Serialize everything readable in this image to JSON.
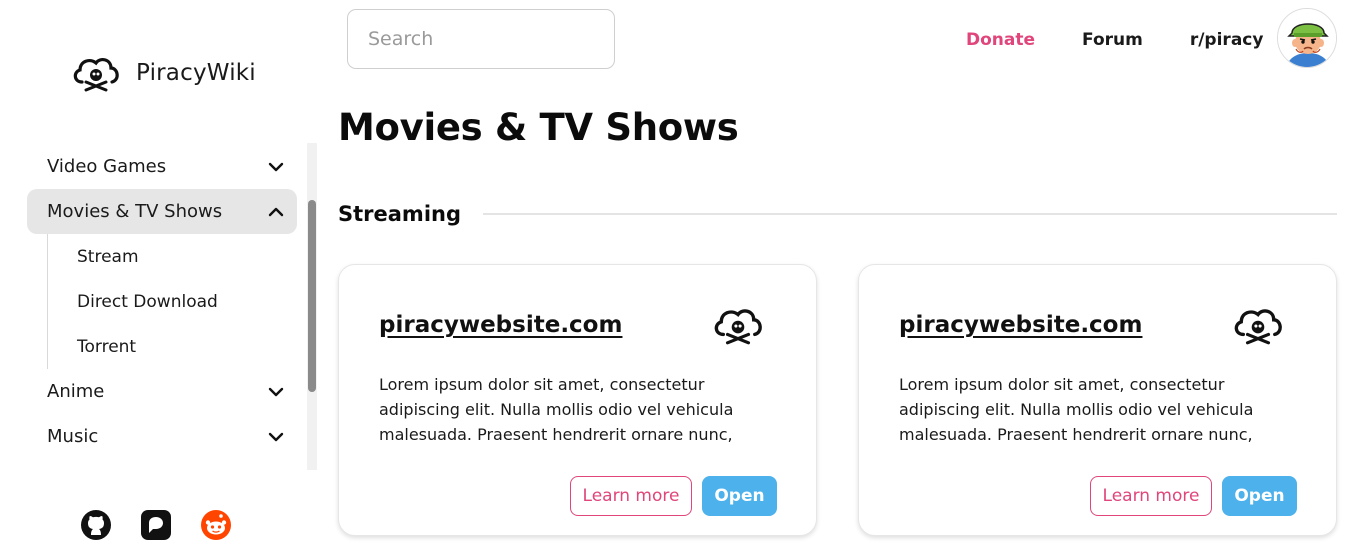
{
  "brand": {
    "name": "PiracyWiki",
    "logo_icon": "cloud-skull-icon"
  },
  "search": {
    "placeholder": "Search",
    "value": ""
  },
  "topnav": {
    "donate": "Donate",
    "forum": "Forum",
    "reddit": "r/piracy",
    "donate_color": "#e0457b"
  },
  "sidebar": {
    "items": [
      {
        "label": "Video Games",
        "expanded": false
      },
      {
        "label": "Movies & TV Shows",
        "expanded": true,
        "active": true
      },
      {
        "label": "Anime",
        "expanded": false
      },
      {
        "label": "Music",
        "expanded": false
      }
    ],
    "sub_items": [
      "Stream",
      "Direct Download",
      "Torrent"
    ],
    "socials": [
      "github-icon",
      "patreon-icon",
      "reddit-icon"
    ]
  },
  "main": {
    "title": "Movies & TV Shows",
    "section": "Streaming",
    "cards": [
      {
        "site": "piracywebsite.com",
        "description": "Lorem ipsum dolor sit amet, consectetur adipiscing elit. Nulla mollis odio vel vehicula malesuada. Praesent hendrerit ornare nunc, rutrum",
        "learn_more": "Learn more",
        "open": "Open"
      },
      {
        "site": "piracywebsite.com",
        "description": "Lorem ipsum dolor sit amet, consectetur adipiscing elit. Nulla mollis odio vel vehicula malesuada. Praesent hendrerit ornare nunc, rutrum tempus ip",
        "learn_more": "Learn more",
        "open": "Open"
      }
    ]
  },
  "colors": {
    "accent_pink": "#e0457b",
    "open_blue": "#4db1ec",
    "active_bg": "#e6e6e6"
  }
}
